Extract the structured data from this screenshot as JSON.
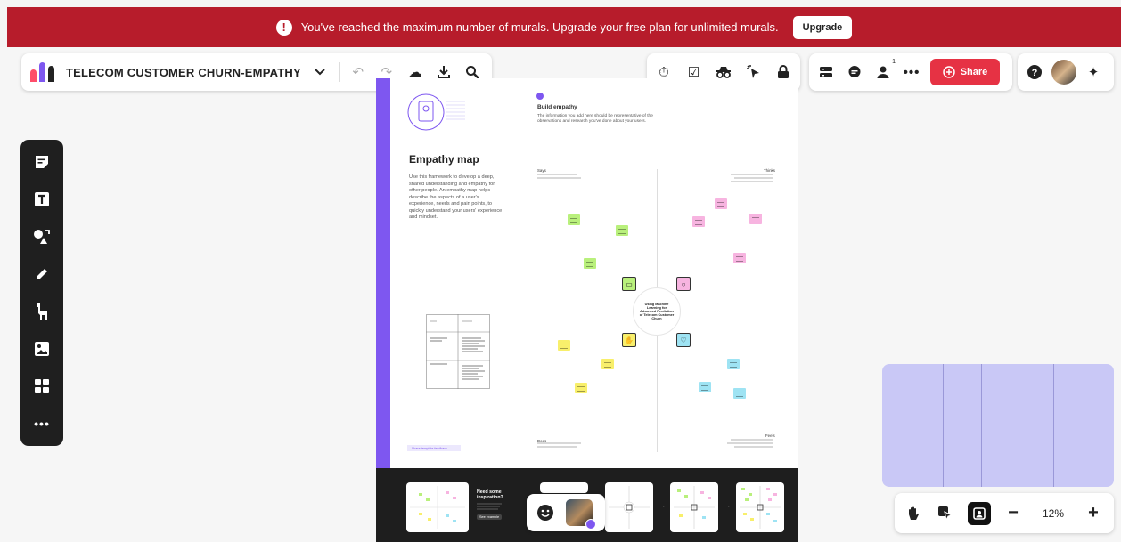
{
  "banner": {
    "message": "You've reached the maximum number of murals. Upgrade your free plan for unlimited murals.",
    "upgrade_label": "Upgrade",
    "color": "#b71c2b"
  },
  "toolbar": {
    "title": "TELECOM CUSTOMER CHURN-EMPATHY",
    "icons": [
      "chevron-down-icon",
      "undo-icon",
      "redo-icon",
      "cloud-sync-icon",
      "download-icon",
      "search-icon"
    ]
  },
  "facilitation": {
    "icons": [
      "timer-icon",
      "voting-icon",
      "private-mode-icon",
      "laser-pointer-icon",
      "lock-icon"
    ]
  },
  "collab": {
    "icons": [
      "outline-icon",
      "comments-icon",
      "members-icon",
      "more-icon"
    ],
    "member_count": "1",
    "share_label": "Share",
    "share_color": "#e63244"
  },
  "help": {
    "icons": [
      "help-icon",
      "avatar",
      "ai-sparkle-icon"
    ]
  },
  "left_tools": [
    "sticky-note-icon",
    "text-icon",
    "shapes-icon",
    "pen-icon",
    "llama-icon",
    "image-icon",
    "templates-icon",
    "more-tools-icon"
  ],
  "template": {
    "empathy_title": "Empathy map",
    "empathy_desc": "Use this framework to develop a deep, shared understanding and empathy for other people. An empathy map helps describe the aspects of a user's experience, needs and pain points, to quickly understand your users' experience and mindset.",
    "build_title": "Build empathy",
    "build_desc": "The information you add here should be representative of the observations and research you've done about your users.",
    "quadrants": {
      "says": "Says",
      "thinks": "Thinks",
      "does": "Does",
      "feels": "Feels"
    },
    "center_text": "Using Machine Learning for Advanced Prediction of Telecom Customer Churn",
    "sticky_colors": {
      "green": "#b9f07c",
      "pink": "#f7b4e0",
      "yellow": "#f8ef6b",
      "blue": "#9ee3f3"
    },
    "need_inspiration": "Need some inspiration?",
    "see_example": "See example",
    "template_feedback": "Share template feedback"
  },
  "minimap": {
    "color": "#c9c8f6"
  },
  "zoom": {
    "value": "12%",
    "icons": [
      "hand-icon",
      "select-icon",
      "fit-icon",
      "zoom-out-icon",
      "zoom-in-icon"
    ]
  },
  "reactions": {
    "icons": [
      "emoji-icon",
      "user-avatar"
    ]
  }
}
